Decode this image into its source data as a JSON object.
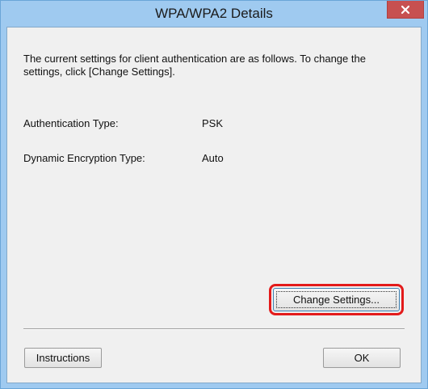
{
  "window": {
    "title": "WPA/WPA2 Details"
  },
  "description": "The current settings for client authentication are as follows. To change the settings, click [Change Settings].",
  "settings": [
    {
      "label": "Authentication Type:",
      "value": "PSK"
    },
    {
      "label": "Dynamic Encryption Type:",
      "value": "Auto"
    }
  ],
  "buttons": {
    "change_settings": "Change Settings...",
    "instructions": "Instructions",
    "ok": "OK"
  },
  "icons": {
    "close": "close-icon"
  },
  "colors": {
    "titlebar": "#9fcaf0",
    "close_button": "#c75050",
    "highlight": "#e31b1b"
  }
}
